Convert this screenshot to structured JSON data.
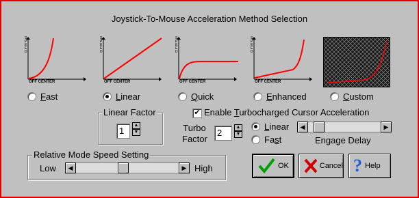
{
  "dialog": {
    "title": "Joystick-To-Mouse Acceleration Method Selection"
  },
  "charts": {
    "axis_x_label": "OFF CENTER",
    "axis_y_label": "SPEED"
  },
  "methods": [
    {
      "label_first": "F",
      "label_rest": "ast",
      "selected": false
    },
    {
      "label_first": "L",
      "label_rest": "inear",
      "selected": true
    },
    {
      "label_first": "Q",
      "label_rest": "uick",
      "selected": false
    },
    {
      "label_first": "E",
      "label_rest": "nhanced",
      "selected": false
    },
    {
      "label_first": "C",
      "label_rest": "ustom",
      "selected": false
    }
  ],
  "linear_factor": {
    "title": "Linear Factor",
    "value": "1"
  },
  "turbo": {
    "checkbox_prefix": "Enable ",
    "checkbox_underlined": "T",
    "checkbox_rest": "urbocharged Cursor Acceleration",
    "checked": true,
    "factor_label_1": "Turbo",
    "factor_label_2": "Factor",
    "factor_value": "2",
    "mode_linear_first": "L",
    "mode_linear_rest": "inear",
    "mode_fast_prefix": "Fa",
    "mode_fast_underlined": "s",
    "mode_fast_rest": "t",
    "mode_selected": "linear",
    "engage_delay_label": "Engage Delay",
    "engage_delay_fraction": 0.05
  },
  "relative_mode": {
    "title": "Relative Mode Speed Setting",
    "low_label": "Low",
    "high_label": "High",
    "value_fraction": 0.45
  },
  "buttons": {
    "ok_label": "OK",
    "cancel_label": "Cancel",
    "help_label": "Help"
  },
  "colors": {
    "curve": "#ff0000",
    "face": "#c0c0c0"
  }
}
